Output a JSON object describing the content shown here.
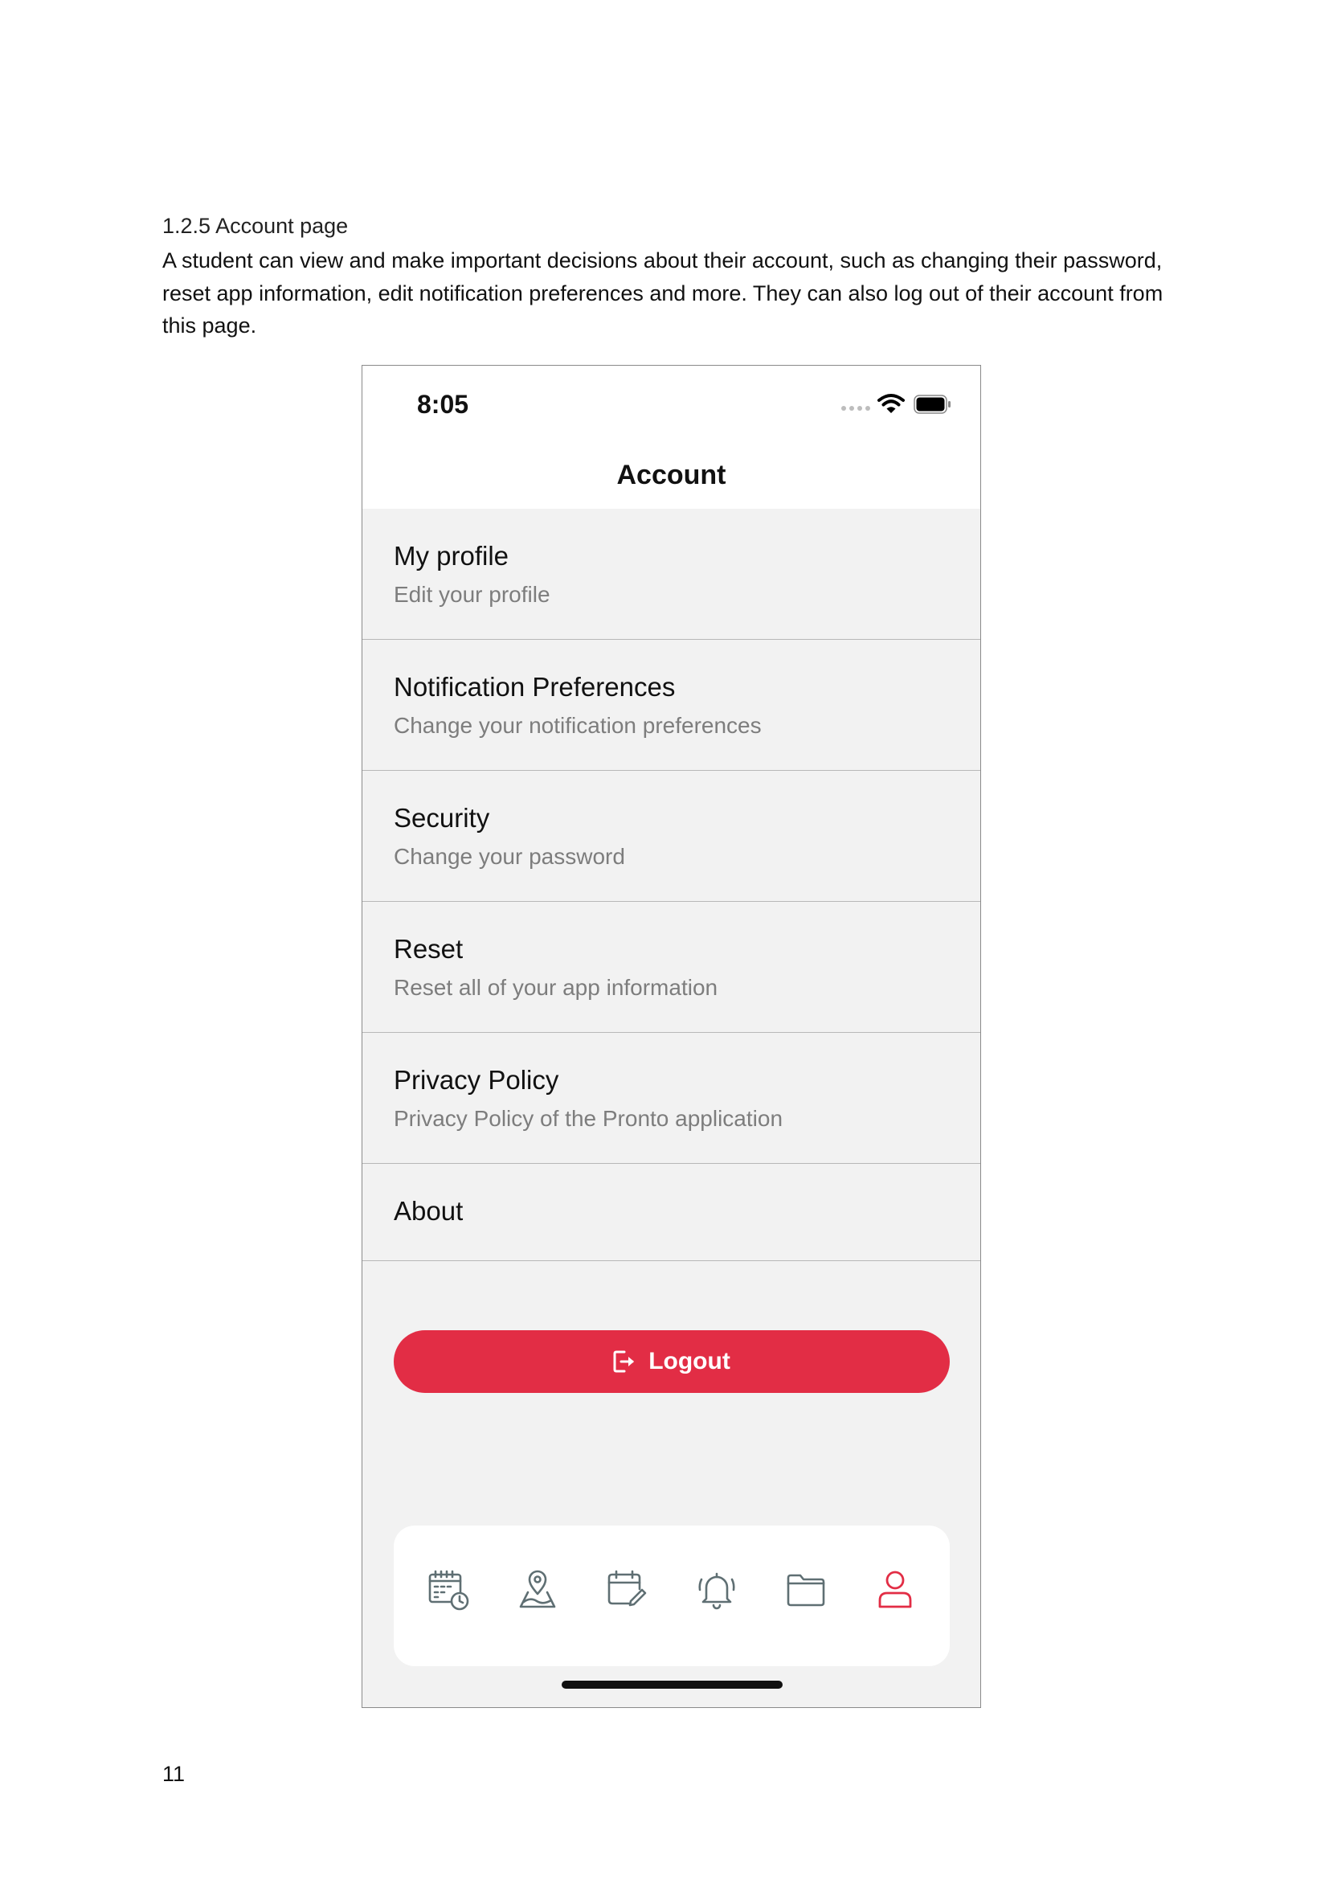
{
  "document": {
    "heading": "1.2.5 Account page",
    "paragraph": "A student can view and make important decisions about their account, such as changing their password, reset app information, edit notification preferences and more. They can also log out of their account from this page.",
    "page_number": "11"
  },
  "phone": {
    "status_bar": {
      "time": "8:05"
    },
    "header": {
      "title": "Account"
    },
    "menu": {
      "items": [
        {
          "title": "My profile",
          "subtitle": "Edit your profile"
        },
        {
          "title": "Notification Preferences",
          "subtitle": "Change your notification preferences"
        },
        {
          "title": "Security",
          "subtitle": "Change your password"
        },
        {
          "title": "Reset",
          "subtitle": "Reset all of your app information"
        },
        {
          "title": "Privacy Policy",
          "subtitle": "Privacy Policy of the Pronto application"
        },
        {
          "title": "About"
        }
      ]
    },
    "logout": {
      "label": "Logout",
      "icon": "logout-icon",
      "color": "#e22d45"
    },
    "tab_bar": {
      "tabs": [
        {
          "icon": "calendar-clock-icon",
          "active": false
        },
        {
          "icon": "map-pin-icon",
          "active": false
        },
        {
          "icon": "calendar-edit-icon",
          "active": false
        },
        {
          "icon": "bell-icon",
          "active": false
        },
        {
          "icon": "folder-icon",
          "active": false
        },
        {
          "icon": "user-icon",
          "active": true
        }
      ],
      "inactive_color": "#5f6f73",
      "active_color": "#e22d45"
    }
  }
}
